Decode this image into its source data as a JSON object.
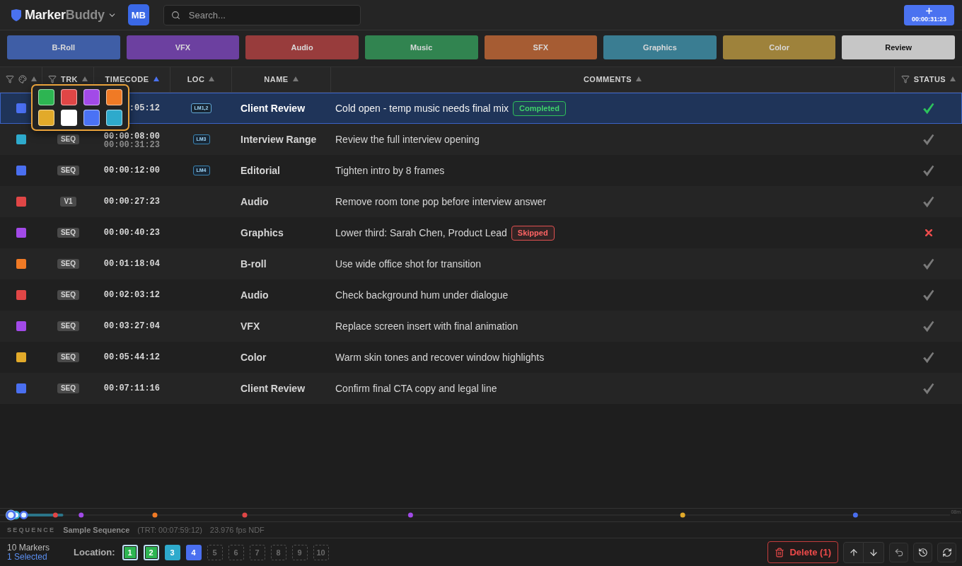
{
  "top_bar": {
    "brand": {
      "primary": "Marker",
      "secondary": "Buddy"
    },
    "avatar": "MB",
    "search": {
      "placeholder": "Search..."
    },
    "add_marker_button": {
      "timecode": "00:00:31:23"
    }
  },
  "category_buttons": [
    {
      "label": "B-Roll",
      "color": "#3f5ea6"
    },
    {
      "label": "VFX",
      "color": "#6c40a0"
    },
    {
      "label": "Audio",
      "color": "#983c3c"
    },
    {
      "label": "Music",
      "color": "#318450"
    },
    {
      "label": "SFX",
      "color": "#a65c33"
    },
    {
      "label": "Graphics",
      "color": "#3a7d92"
    },
    {
      "label": "Color",
      "color": "#9e823b"
    },
    {
      "label": "Review",
      "color": "#c6c6c6"
    }
  ],
  "table": {
    "columns": [
      {
        "kind": "color",
        "filter": true,
        "sorted": false
      },
      {
        "kind": "text",
        "label": "TRK",
        "filter": true,
        "sorted": false
      },
      {
        "kind": "text",
        "label": "TIMECODE",
        "filter": false,
        "sorted": true
      },
      {
        "kind": "text",
        "label": "LOC",
        "filter": false,
        "sorted": false
      },
      {
        "kind": "text",
        "label": "NAME",
        "filter": false,
        "sorted": false
      },
      {
        "kind": "text",
        "label": "COMMENTS",
        "filter": false,
        "sorted": false
      },
      {
        "kind": "text",
        "label": "STATUS",
        "filter": true,
        "sorted": false
      }
    ],
    "rows": [
      {
        "color": "#4a6ff0",
        "timecode": ":05:12",
        "location": "LM1,2",
        "name": "Client Review",
        "comment": "Cold open - temp music needs final mix",
        "badge": "Completed",
        "completed": true,
        "skipped": false,
        "selected": true
      },
      {
        "color": "#2eaacc",
        "track": "SEQ",
        "timecode": "00:00:08:00",
        "timecode_out": "00:00:31:23",
        "location": "LM3",
        "name": "Interview Range",
        "comment": "Review the full interview opening",
        "completed": false,
        "skipped": false,
        "selected": false
      },
      {
        "color": "#4a6ff0",
        "track": "SEQ",
        "timecode": "00:00:12:00",
        "location": "LM4",
        "name": "Editorial",
        "comment": "Tighten intro by 8 frames",
        "completed": false,
        "skipped": false,
        "selected": false
      },
      {
        "color": "#e04646",
        "track": "V1",
        "timecode": "00:00:27:23",
        "name": "Audio",
        "comment": "Remove room tone pop before interview answer",
        "completed": false,
        "skipped": false,
        "selected": false
      },
      {
        "color": "#a24ae8",
        "track": "SEQ",
        "timecode": "00:00:40:23",
        "name": "Graphics",
        "comment": "Lower third: Sarah Chen, Product Lead",
        "badge": "Skipped",
        "completed": false,
        "skipped": true,
        "selected": false
      },
      {
        "color": "#f07a25",
        "track": "SEQ",
        "timecode": "00:01:18:04",
        "name": "B-roll",
        "comment": "Use wide office shot for transition",
        "completed": false,
        "skipped": false,
        "selected": false
      },
      {
        "color": "#e04646",
        "track": "SEQ",
        "timecode": "00:02:03:12",
        "name": "Audio",
        "comment": "Check background hum under dialogue",
        "completed": false,
        "skipped": false,
        "selected": false
      },
      {
        "color": "#a24ae8",
        "track": "SEQ",
        "timecode": "00:03:27:04",
        "name": "VFX",
        "comment": "Replace screen insert with final animation",
        "completed": false,
        "skipped": false,
        "selected": false
      },
      {
        "color": "#e2aa2a",
        "track": "SEQ",
        "timecode": "00:05:44:12",
        "name": "Color",
        "comment": "Warm skin tones and recover window highlights",
        "completed": false,
        "skipped": false,
        "selected": false
      },
      {
        "color": "#4a6ff0",
        "track": "SEQ",
        "timecode": "00:07:11:16",
        "name": "Client Review",
        "comment": "Confirm final CTA copy and legal line",
        "completed": false,
        "skipped": false,
        "selected": false
      }
    ]
  },
  "color_picker": {
    "swatches": [
      {
        "color": "#2db552"
      },
      {
        "color": "#e04646"
      },
      {
        "color": "#a24ae8"
      },
      {
        "color": "#f07a25"
      },
      {
        "color": "#e2aa2a"
      },
      {
        "color": "#ffffff"
      },
      {
        "color": "#4a72f5"
      },
      {
        "color": "#2eaacc"
      }
    ]
  },
  "timeline": {
    "end_label": "08m"
  },
  "sequence_bar": {
    "label": "SEQUENCE",
    "name": "Sample Sequence",
    "duration": "(TRT: 00:07:59:12)",
    "frame_rate": "23.976 fps NDF"
  },
  "footer": {
    "marker_count": "10 Markers",
    "selection_count": "1 Selected",
    "location_label": "Location:",
    "locations": [
      {
        "label": "1",
        "color": "#2db552",
        "selected": true
      },
      {
        "label": "2",
        "color": "#2db552",
        "selected": true
      },
      {
        "label": "3",
        "color": "#2eaacc",
        "selected": false
      },
      {
        "label": "4",
        "color": "#4a6ff0",
        "selected": false
      },
      {
        "label": "5",
        "selected": false
      },
      {
        "label": "6",
        "selected": false
      },
      {
        "label": "7",
        "selected": false
      },
      {
        "label": "8",
        "selected": false
      },
      {
        "label": "9",
        "selected": false
      },
      {
        "label": "10",
        "selected": false
      }
    ],
    "delete_button": "Delete (1)"
  }
}
